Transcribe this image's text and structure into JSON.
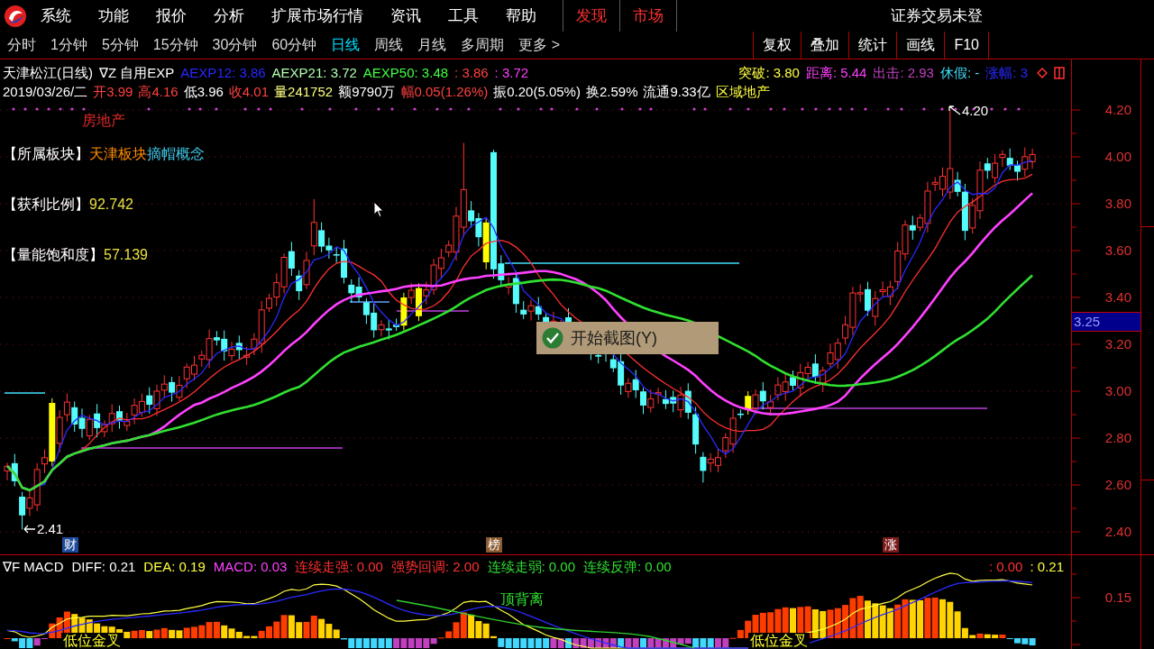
{
  "menu_bar": {
    "items": [
      {
        "label": "系统",
        "featured": false
      },
      {
        "label": "功能",
        "featured": false
      },
      {
        "label": "报价",
        "featured": false
      },
      {
        "label": "分析",
        "featured": false
      },
      {
        "label": "扩展市场行情",
        "featured": false
      },
      {
        "label": "资讯",
        "featured": false
      },
      {
        "label": "工具",
        "featured": false
      },
      {
        "label": "帮助",
        "featured": false
      },
      {
        "label": "发现",
        "featured": true
      },
      {
        "label": "市场",
        "featured": true
      }
    ],
    "login_status": "证券交易未登"
  },
  "period_bar": {
    "tabs": [
      {
        "label": "分时",
        "selected": false
      },
      {
        "label": "1分钟",
        "selected": false
      },
      {
        "label": "5分钟",
        "selected": false
      },
      {
        "label": "15分钟",
        "selected": false
      },
      {
        "label": "30分钟",
        "selected": false
      },
      {
        "label": "60分钟",
        "selected": false
      },
      {
        "label": "日线",
        "selected": true
      },
      {
        "label": "周线",
        "selected": false
      },
      {
        "label": "月线",
        "selected": false
      },
      {
        "label": "多周期",
        "selected": false
      },
      {
        "label": "更多 >",
        "selected": false
      }
    ],
    "buttons": [
      "复权",
      "叠加",
      "统计",
      "画线",
      "F10"
    ]
  },
  "title_line": {
    "left": [
      {
        "text": "天津松江(日线)",
        "color": "#ffffff"
      },
      {
        "text": "∇Z 自用EXP",
        "color": "#ffffff"
      },
      {
        "text": "AEXP12: 3.86",
        "color": "#2828ff"
      },
      {
        "text": "AEXP21: 3.72",
        "color": "#b0ffb0"
      },
      {
        "text": "AEXP50: 3.48",
        "color": "#40ff40"
      },
      {
        "text": ": 3.86",
        "color": "#ff4040"
      },
      {
        "text": ": 3.72",
        "color": "#ff40ff"
      }
    ],
    "right": [
      {
        "text": "突破: 3.80",
        "color": "#ffff40"
      },
      {
        "text": "距离: 5.44",
        "color": "#ff40ff"
      },
      {
        "text": "出击: 2.93",
        "color": "#c040c0"
      },
      {
        "text": "休假: -",
        "color": "#40e0ff"
      },
      {
        "text": "涨幅: 3",
        "color": "#2828ff"
      }
    ]
  },
  "quote_line": [
    {
      "text": "2019/03/26/二",
      "color": "#ffffff"
    },
    {
      "text": "开3.99",
      "color": "#ff4040"
    },
    {
      "text": "高4.16",
      "color": "#ff4040"
    },
    {
      "text": "低3.96",
      "color": "#ffffff"
    },
    {
      "text": "收4.01",
      "color": "#ff4040"
    },
    {
      "text": "量241752",
      "color": "#ffff80"
    },
    {
      "text": "额9790万",
      "color": "#ffffff"
    },
    {
      "text": "幅0.05(1.26%)",
      "color": "#ff4040"
    },
    {
      "text": "振0.20(5.05%)",
      "color": "#ffffff"
    },
    {
      "text": "换2.59%",
      "color": "#ffffff"
    },
    {
      "text": "流通9.33亿",
      "color": "#ffffff"
    },
    {
      "text": "区域地产",
      "color": "#ffff40"
    }
  ],
  "sector_label": "房地产",
  "annotations": [
    {
      "label": "【所属板块】",
      "values": [
        {
          "text": "天津板块",
          "color": "#ff8c00"
        },
        {
          "text": "摘帽概念",
          "color": "#40c8e8"
        }
      ]
    },
    {
      "label": "【获利比例】",
      "values": [
        {
          "text": "92.742",
          "color": "#e8e040"
        }
      ]
    },
    {
      "label": "【量能饱和度】",
      "values": [
        {
          "text": "57.139",
          "color": "#e8e040"
        }
      ]
    }
  ],
  "chart_marks": {
    "high_label": "4.20",
    "low_label": "2.41",
    "tags": [
      {
        "text": "财",
        "color": "#1e4a9a"
      },
      {
        "text": "榜",
        "color": "#8a5a30"
      },
      {
        "text": "涨",
        "color": "#7a1a1a"
      }
    ]
  },
  "screenshot_menu": {
    "label": "开始截图(Y)"
  },
  "price_axis": {
    "ticks": [
      "4.20",
      "4.00",
      "3.80",
      "3.60",
      "3.40",
      "3.20",
      "3.00",
      "2.80",
      "2.60",
      "2.40"
    ],
    "current_price": "3.25"
  },
  "macd_panel": {
    "legend": [
      {
        "text": "∇F MACD",
        "color": "#ffffff"
      },
      {
        "text": "DIFF: 0.21",
        "color": "#ffffff"
      },
      {
        "text": "DEA: 0.19",
        "color": "#ffff40"
      },
      {
        "text": "MACD: 0.03",
        "color": "#ff40ff"
      },
      {
        "text": "连续走强: 0.00",
        "color": "#ff3030"
      },
      {
        "text": "强势回调: 2.00",
        "color": "#ff3030"
      },
      {
        "text": "连续走弱: 0.00",
        "color": "#30e030"
      },
      {
        "text": "连续反弹: 0.00",
        "color": "#30e030"
      }
    ],
    "right_values": [
      {
        "text": ": 0.00",
        "color": "#ff3030"
      },
      {
        "text": ": 0.21",
        "color": "#ffff40"
      }
    ],
    "axis_ticks": [
      "0.15"
    ],
    "signals": [
      {
        "text": "顶背离",
        "kind": "divergence"
      },
      {
        "text": "低位金叉",
        "kind": "golden_cross"
      },
      {
        "text": "低位金叉",
        "kind": "golden_cross"
      }
    ]
  }
}
